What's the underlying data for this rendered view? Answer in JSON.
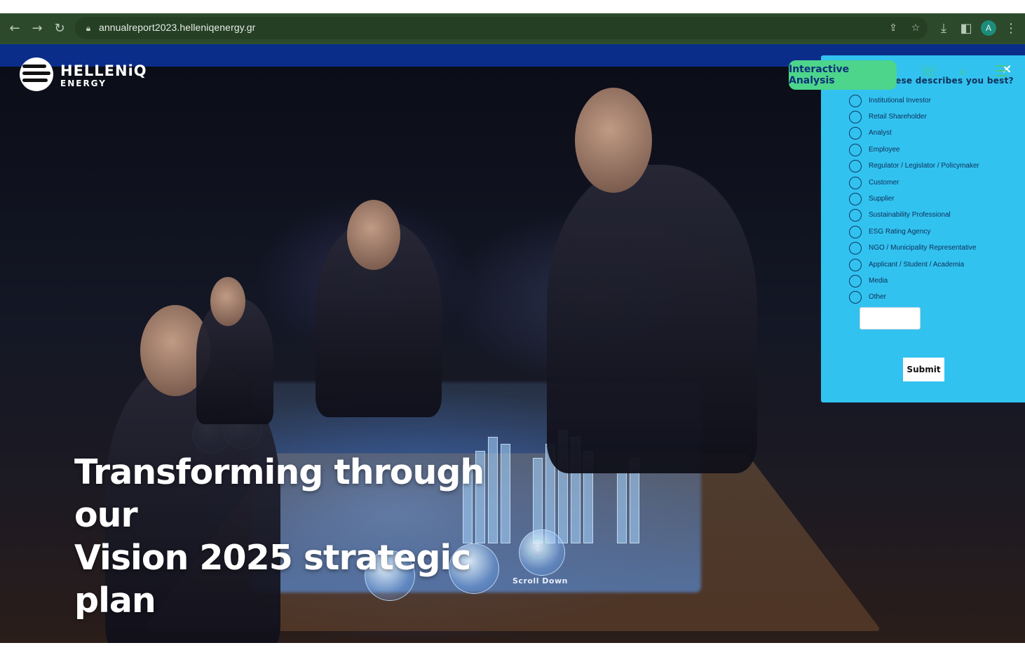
{
  "browser": {
    "url": "annualreport2023.helleniqenergy.gr",
    "profile_initial": "A",
    "icons": [
      "back-icon",
      "forward-icon",
      "reload-icon",
      "lock-icon",
      "share-icon",
      "star-icon",
      "download-icon",
      "sidepanel-icon",
      "menu-dots-icon"
    ]
  },
  "site": {
    "logo_title": "HELLENiQ",
    "logo_subtitle": "ENERGY",
    "headline_line1": "Transforming through our",
    "headline_line2": "Vision 2025 strategic plan",
    "scroll_label": "Scroll Down",
    "header_icons": [
      "phone-icon",
      "search-icon",
      "hamburger-menu-icon"
    ]
  },
  "survey": {
    "question": "ese describes you best?",
    "close_glyph": "×",
    "options": [
      "Institutional Investor",
      "Retail Shareholder",
      "Analyst",
      "Employee",
      "Regulator / Legislator / Policymaker",
      "Customer",
      "Supplier",
      "Sustainability Professional",
      "ESG Rating Agency",
      "NGO / Municipality Representative",
      "Applicant / Student / Academia",
      "Media",
      "Other"
    ],
    "other_value": "",
    "submit_label": "Submit",
    "badge_label": "Interactive Analysis"
  },
  "colors": {
    "browser_toolbar": "#2c4a2b",
    "site_bar": "#0b2d8a",
    "panel_bg": "#32c2f0",
    "badge_bg": "#4cd58b",
    "accent_green": "#43c98e"
  }
}
